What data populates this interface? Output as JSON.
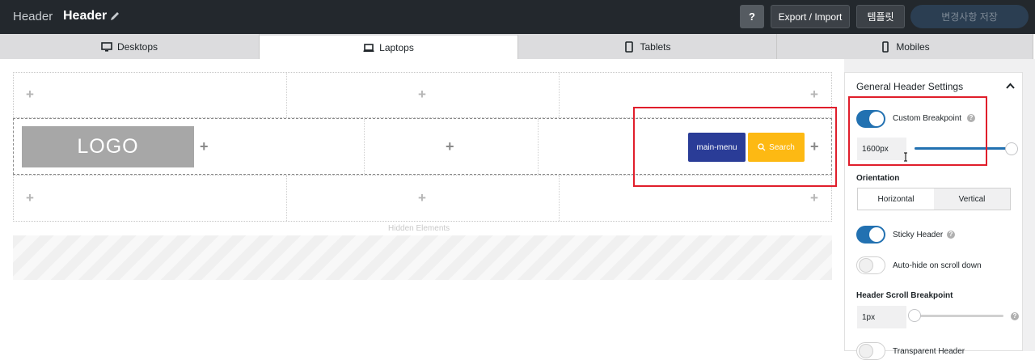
{
  "topbar": {
    "crumb": "Header",
    "title": "Header",
    "help_label": "?",
    "export_label": "Export / Import",
    "template_label": "템플릿",
    "save_label": "변경사항 저장"
  },
  "tabs": [
    {
      "label": "Desktops",
      "icon": "desktop-icon"
    },
    {
      "label": "Laptops",
      "icon": "laptop-icon"
    },
    {
      "label": "Tablets",
      "icon": "tablet-icon"
    },
    {
      "label": "Mobiles",
      "icon": "mobile-icon"
    }
  ],
  "builder": {
    "plus": "+",
    "logo_label": "LOGO",
    "menu_label": "main-menu",
    "search_label": "Search",
    "hidden_label": "Hidden Elements"
  },
  "panel": {
    "title": "General Header Settings",
    "custom_breakpoint": {
      "label": "Custom Breakpoint",
      "enabled": true,
      "value": "1600px",
      "level": 1.0
    },
    "orientation": {
      "label": "Orientation",
      "options": [
        "Horizontal",
        "Vertical"
      ],
      "selected": "Horizontal"
    },
    "sticky_header": {
      "label": "Sticky Header",
      "enabled": true
    },
    "auto_hide": {
      "label": "Auto-hide on scroll down",
      "enabled": false
    },
    "scroll_breakpoint": {
      "label": "Header Scroll Breakpoint",
      "value": "1px",
      "level": 0.0
    },
    "transparent_header": {
      "label": "Transparent Header",
      "enabled": false
    }
  },
  "colors": {
    "accent": "#2271b1",
    "menu": "#2a3c97",
    "search": "#fdb913",
    "highlight": "#e01e2b"
  }
}
